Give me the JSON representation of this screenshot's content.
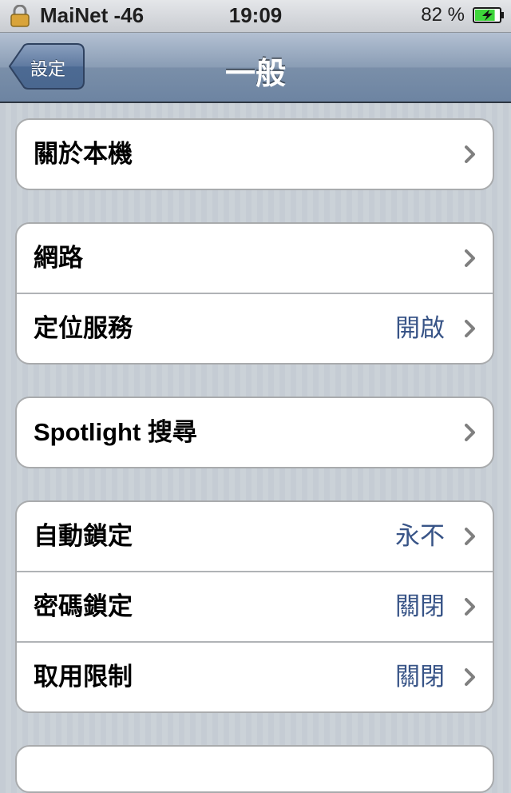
{
  "status_bar": {
    "carrier": "MaiNet",
    "signal": "-46",
    "time": "19:09",
    "battery_percent": "82 %",
    "battery_level": 0.82,
    "battery_color": "#3fd63b"
  },
  "nav": {
    "back_label": "設定",
    "title": "一般"
  },
  "groups": [
    {
      "rows": [
        {
          "label": "關於本機",
          "value": ""
        }
      ]
    },
    {
      "rows": [
        {
          "label": "網路",
          "value": ""
        },
        {
          "label": "定位服務",
          "value": "開啟"
        }
      ]
    },
    {
      "rows": [
        {
          "label": "Spotlight 搜尋",
          "value": ""
        }
      ]
    },
    {
      "rows": [
        {
          "label": "自動鎖定",
          "value": "永不"
        },
        {
          "label": "密碼鎖定",
          "value": "關閉"
        },
        {
          "label": "取用限制",
          "value": "關閉"
        }
      ]
    }
  ],
  "colors": {
    "value_text": "#385487",
    "nav_bar": "#6d84a2",
    "background": "#c5ccd4"
  }
}
